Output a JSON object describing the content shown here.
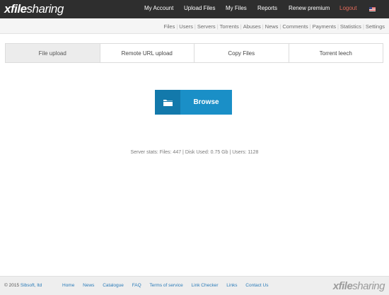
{
  "header": {
    "logo": {
      "x": "x",
      "file": "file",
      "sharing": "sharing"
    },
    "nav": [
      {
        "label": "My Account"
      },
      {
        "label": "Upload Files"
      },
      {
        "label": "My Files"
      },
      {
        "label": "Reports"
      },
      {
        "label": "Renew premium"
      },
      {
        "label": "Logout"
      }
    ],
    "flag_icon": "us-flag-icon"
  },
  "admin_nav": [
    "Files",
    "Users",
    "Servers",
    "Torrents",
    "Abuses",
    "News",
    "Comments",
    "Payments",
    "Statistics",
    "Settings"
  ],
  "tabs": [
    {
      "label": "File upload",
      "active": true
    },
    {
      "label": "Remote URL upload"
    },
    {
      "label": "Copy Files"
    },
    {
      "label": "Torrent leech"
    }
  ],
  "browse": {
    "label": "Browse",
    "icon": "folder-icon"
  },
  "stats": "Server stats: Files: 447 | Disk Used: 0.75 Gb | Users: 1128",
  "footer": {
    "copyright_prefix": "© 2015",
    "company": "Sibsoft, ltd",
    "links": [
      "Home",
      "News",
      "Catalogue",
      "FAQ",
      "Terms of service",
      "Link Checker",
      "Links",
      "Contact Us"
    ],
    "logo": {
      "x": "x",
      "file": "file",
      "sharing": "sharing"
    }
  },
  "colors": {
    "topbar": "#2e2e2e",
    "accent": "#1a8fc7",
    "logout": "#e26a5a",
    "link": "#2a7bb8"
  }
}
